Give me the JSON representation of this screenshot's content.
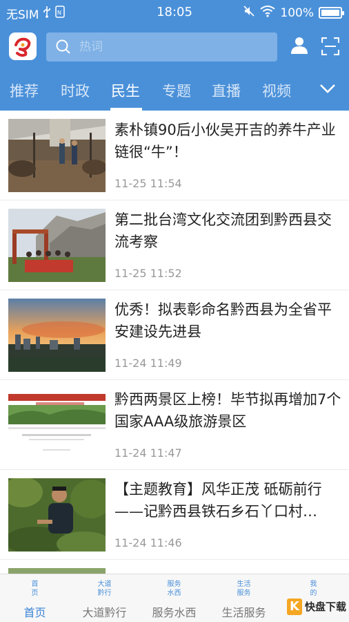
{
  "status_bar": {
    "carrier": "无SIM",
    "time": "18:05",
    "battery": "100%"
  },
  "search": {
    "placeholder": "热词"
  },
  "tabs": [
    {
      "label": "推荐"
    },
    {
      "label": "时政"
    },
    {
      "label": "民生"
    },
    {
      "label": "专题"
    },
    {
      "label": "直播"
    },
    {
      "label": "视频"
    }
  ],
  "news": [
    {
      "title": "素朴镇90后小伙吴开吉的养牛产业链很“牛”！",
      "time": "11-25 11:54"
    },
    {
      "title": "第二批台湾文化交流团到黔西县交流考察",
      "time": "11-25 11:52"
    },
    {
      "title": "优秀！拟表彰命名黔西县为全省平安建设先进县",
      "time": "11-24 11:49"
    },
    {
      "title": "黔西两景区上榜！毕节拟再增加7个国家AAA级旅游景区",
      "time": "11-24 11:47"
    },
    {
      "title": "【主题教育】风华正茂 砥砺前行——记黔西县铁石乡石丫口村…",
      "time": "11-24 11:46"
    }
  ],
  "bottom_nav": [
    {
      "icon_text": "首\n页",
      "label": "首页"
    },
    {
      "icon_text": "大道\n黔行",
      "label": "大道黔行"
    },
    {
      "icon_text": "服务\n水西",
      "label": "服务水西"
    },
    {
      "icon_text": "生活\n服务",
      "label": "生活服务"
    },
    {
      "icon_text": "我\n的",
      "label": ""
    }
  ],
  "watermark": {
    "letter": "K",
    "text": "快盘下载"
  },
  "colors": {
    "brand_blue": "#4a90d9",
    "active_nav": "#3a84d6"
  }
}
